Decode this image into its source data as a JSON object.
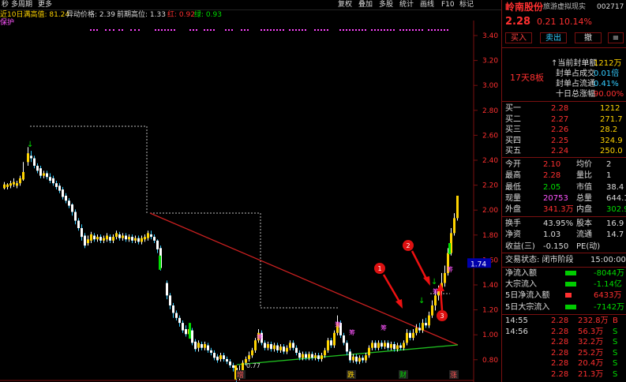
{
  "topbar": {
    "left_items": [
      "秒",
      "多周期",
      "更多"
    ],
    "right_items": [
      "复权",
      "叠加",
      "多股",
      "统计",
      "画线",
      "F10",
      "标记"
    ]
  },
  "infobar": {
    "ma10_label": "近10日满高值: 81.24",
    "abnormal_price": "异动价格: 2.39",
    "prev_high": "前期高位: 1.33",
    "red_label": "红: 0.92",
    "green_label": "绿: 0.93",
    "sub_label": "保护"
  },
  "axis": {
    "ticks": [
      "3.40",
      "3.20",
      "3.00",
      "2.80",
      "2.60",
      "2.40",
      "2.20",
      "2.00",
      "1.80",
      "1.60",
      "1.40",
      "1.20",
      "1.00",
      "0.80"
    ],
    "current_marker": "1.74",
    "low_label": "0.77"
  },
  "markers": {
    "bottom": [
      "增",
      "跌",
      "财",
      "涨"
    ],
    "bar_tags": [
      "筹",
      "筹",
      "筹",
      "筹",
      "筹",
      "筹"
    ],
    "circles": [
      "1",
      "2",
      "3"
    ]
  },
  "panel": {
    "title": "岭南股份",
    "code": "002717",
    "subtitle": "旅游虚拟现实",
    "price": "2.28",
    "change": "0.21",
    "pct": "10.14%",
    "buttons": [
      "买入",
      "卖出",
      "撤"
    ],
    "streak": "17天8板",
    "seal_stats": [
      {
        "label": "当前封单额",
        "value": "1212万"
      },
      {
        "label": "封单占成交",
        "value": "0.01倍"
      },
      {
        "label": "封单占流通",
        "value": "0.41%"
      },
      {
        "label": "十日总涨幅",
        "value": "90.00%"
      }
    ],
    "bids": [
      {
        "label": "买一",
        "price": "2.28",
        "vol": "1212"
      },
      {
        "label": "买二",
        "price": "2.27",
        "vol": "271.7"
      },
      {
        "label": "买三",
        "price": "2.26",
        "vol": "28.2"
      },
      {
        "label": "买四",
        "price": "2.25",
        "vol": "324.9"
      },
      {
        "label": "买五",
        "price": "2.24",
        "vol": "250.0"
      }
    ],
    "quote": [
      {
        "l1": "今开",
        "v1": "2.10",
        "l2": "均价",
        "v2": "2"
      },
      {
        "l1": "最高",
        "v1": "2.28",
        "l2": "量比",
        "v2": "1"
      },
      {
        "l1": "最低",
        "v1": "2.05",
        "l2": "市值",
        "v2": "38.4"
      },
      {
        "l1": "现量",
        "v1": "20753",
        "l2": "总量",
        "v2": "644.1"
      },
      {
        "l1": "外盘",
        "v1": "341.3万",
        "l2": "内盘",
        "v2": "302.9"
      }
    ],
    "ratios": [
      {
        "l1": "换手",
        "v1": "43.95%",
        "l2": "股本",
        "v2": "16.9"
      },
      {
        "l1": "净资",
        "v1": "1.03",
        "l2": "流通",
        "v2": "14.7"
      },
      {
        "l1": "收益(三)",
        "v1": "-0.150",
        "l2": "PE(动)",
        "v2": ""
      }
    ],
    "trade_status": "交易状态: 闭市阶段",
    "trade_time": "15:00:00",
    "flows": [
      {
        "label": "净流入额",
        "value": "-8044万"
      },
      {
        "label": "大宗流入",
        "value": "-1.14亿"
      },
      {
        "label": "5日净流入额",
        "value": "6433万"
      },
      {
        "label": "5日大宗流入",
        "value": "-7142万"
      }
    ],
    "ticks": [
      {
        "time": "14:55",
        "price": "2.28",
        "vol": "232.8万",
        "side": "B"
      },
      {
        "time": "14:56",
        "price": "2.28",
        "vol": "56.3万",
        "side": "S"
      },
      {
        "time": "",
        "price": "2.28",
        "vol": "32.2万",
        "side": "S"
      },
      {
        "time": "",
        "price": "2.28",
        "vol": "25.2万",
        "side": "S"
      },
      {
        "time": "",
        "price": "2.28",
        "vol": "20.4万",
        "side": "S"
      },
      {
        "time": "",
        "price": "2.28",
        "vol": "21.3万",
        "side": "S"
      }
    ]
  }
}
